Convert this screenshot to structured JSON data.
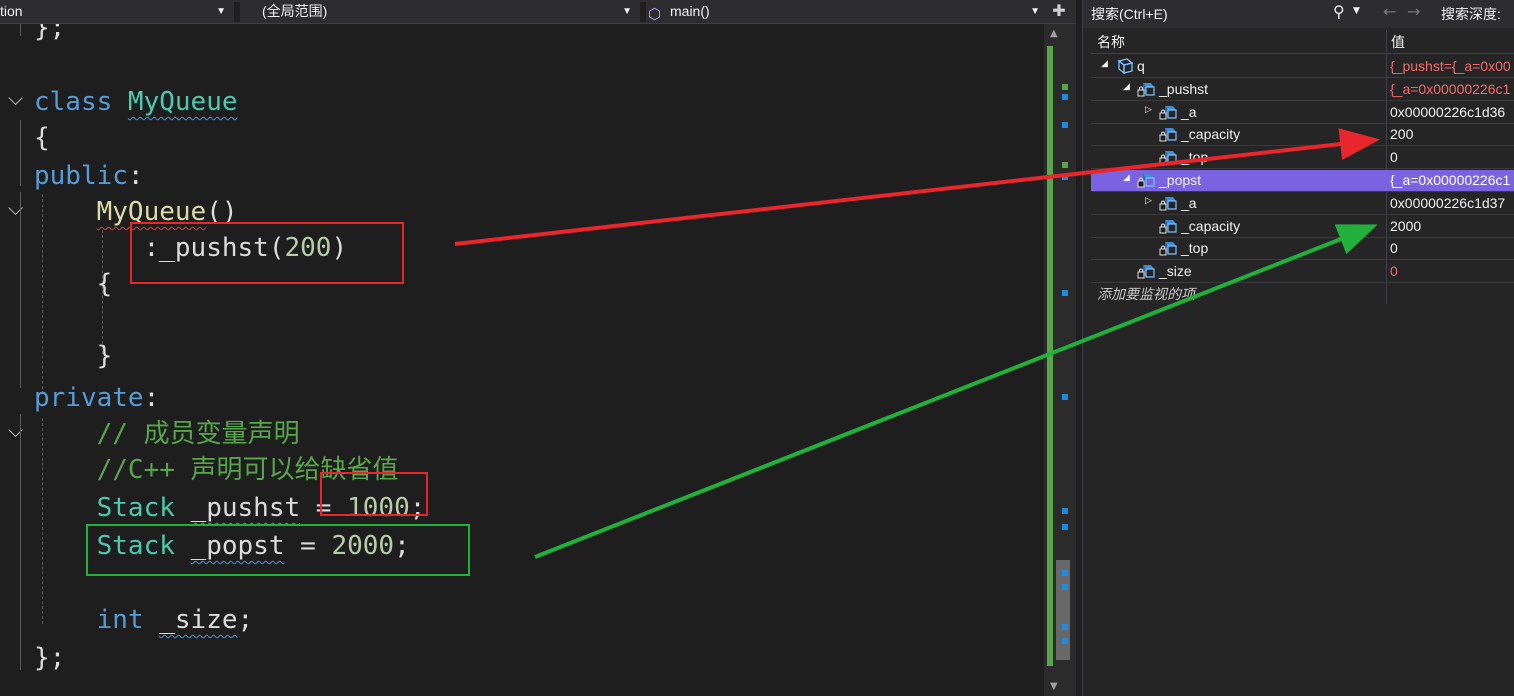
{
  "navbar": {
    "project": "tion",
    "scope": "(全局范围)",
    "member": "main()"
  },
  "code": {
    "lines": [
      {
        "segments": [
          {
            "t": "};",
            "c": "pl"
          }
        ]
      },
      {
        "segments": [
          {
            "t": "class ",
            "c": "kw"
          },
          {
            "t": "MyQueue",
            "c": "ty sq"
          }
        ]
      },
      {
        "segments": [
          {
            "t": "{",
            "c": "pl"
          }
        ]
      },
      {
        "segments": [
          {
            "t": "public",
            "c": "kw"
          },
          {
            "t": ":",
            "c": "pl"
          }
        ]
      },
      {
        "segments": [
          {
            "t": "    ",
            "c": "pl"
          },
          {
            "t": "MyQueue",
            "c": "fn sqr"
          },
          {
            "t": "()",
            "c": "pl"
          }
        ]
      },
      {
        "segments": [
          {
            "t": "       :",
            "c": "pl"
          },
          {
            "t": "_pushst",
            "c": "pl"
          },
          {
            "t": "(",
            "c": "pl"
          },
          {
            "t": "200",
            "c": "nm"
          },
          {
            "t": ")",
            "c": "pl"
          }
        ]
      },
      {
        "segments": [
          {
            "t": "    {",
            "c": "pl"
          }
        ]
      },
      {
        "segments": [
          {
            "t": "",
            "c": "pl"
          }
        ]
      },
      {
        "segments": [
          {
            "t": "    }",
            "c": "pl"
          }
        ]
      },
      {
        "segments": [
          {
            "t": "private",
            "c": "kw"
          },
          {
            "t": ":",
            "c": "pl"
          }
        ]
      },
      {
        "segments": [
          {
            "t": "    ",
            "c": "pl"
          },
          {
            "t": "// 成员变量声明",
            "c": "cm"
          }
        ]
      },
      {
        "segments": [
          {
            "t": "    ",
            "c": "pl"
          },
          {
            "t": "//C++ 声明可以给缺省值",
            "c": "cm"
          }
        ]
      },
      {
        "segments": [
          {
            "t": "    ",
            "c": "pl"
          },
          {
            "t": "Stack",
            "c": "ty"
          },
          {
            "t": " ",
            "c": "pl"
          },
          {
            "t": "_pushst",
            "c": "pl sq"
          },
          {
            "t": " = ",
            "c": "pl"
          },
          {
            "t": "1000",
            "c": "nm"
          },
          {
            "t": ";",
            "c": "pl"
          }
        ]
      },
      {
        "segments": [
          {
            "t": "    ",
            "c": "pl"
          },
          {
            "t": "Stack",
            "c": "ty"
          },
          {
            "t": " ",
            "c": "pl"
          },
          {
            "t": "_popst",
            "c": "pl sq"
          },
          {
            "t": " = ",
            "c": "pl"
          },
          {
            "t": "2000",
            "c": "nm"
          },
          {
            "t": ";",
            "c": "pl"
          }
        ]
      },
      {
        "segments": [
          {
            "t": "",
            "c": "pl"
          }
        ]
      },
      {
        "segments": [
          {
            "t": "    ",
            "c": "pl"
          },
          {
            "t": "int",
            "c": "kw"
          },
          {
            "t": " ",
            "c": "pl"
          },
          {
            "t": "_size",
            "c": "pl sq"
          },
          {
            "t": ";",
            "c": "pl"
          }
        ]
      },
      {
        "segments": [
          {
            "t": "};",
            "c": "pl"
          }
        ]
      }
    ]
  },
  "watch": {
    "search_label": "搜索(Ctrl+E)",
    "depth_label": "搜索深度:",
    "col_name": "名称",
    "col_value": "值",
    "rows": [
      {
        "name": "q",
        "value": "{_pushst={_a=0x00",
        "indent": 0,
        "expander": "open",
        "red": true,
        "selected": false,
        "icon": "struct"
      },
      {
        "name": "_pushst",
        "value": "{_a=0x00000226c1",
        "indent": 1,
        "expander": "open",
        "red": true,
        "selected": false,
        "icon": "field"
      },
      {
        "name": "_a",
        "value": "0x00000226c1d36",
        "indent": 2,
        "expander": "closed",
        "red": false,
        "selected": false,
        "icon": "field"
      },
      {
        "name": "_capacity",
        "value": "200",
        "indent": 2,
        "expander": "none",
        "red": false,
        "selected": false,
        "icon": "field"
      },
      {
        "name": "_top",
        "value": "0",
        "indent": 2,
        "expander": "none",
        "red": false,
        "selected": false,
        "icon": "field"
      },
      {
        "name": "_popst",
        "value": "{_a=0x00000226c1",
        "indent": 1,
        "expander": "open",
        "red": true,
        "selected": true,
        "icon": "field"
      },
      {
        "name": "_a",
        "value": "0x00000226c1d37",
        "indent": 2,
        "expander": "closed",
        "red": false,
        "selected": false,
        "icon": "field"
      },
      {
        "name": "_capacity",
        "value": "2000",
        "indent": 2,
        "expander": "none",
        "red": false,
        "selected": false,
        "icon": "field"
      },
      {
        "name": "_top",
        "value": "0",
        "indent": 2,
        "expander": "none",
        "red": false,
        "selected": false,
        "icon": "field"
      },
      {
        "name": "_size",
        "value": "0",
        "indent": 1,
        "expander": "none",
        "red": true,
        "selected": false,
        "icon": "field"
      }
    ],
    "add_item": "添加要监视的项"
  },
  "colors": {
    "annotation_red": "#e8262b",
    "annotation_green": "#22b03c",
    "selection": "#7a63e0"
  }
}
